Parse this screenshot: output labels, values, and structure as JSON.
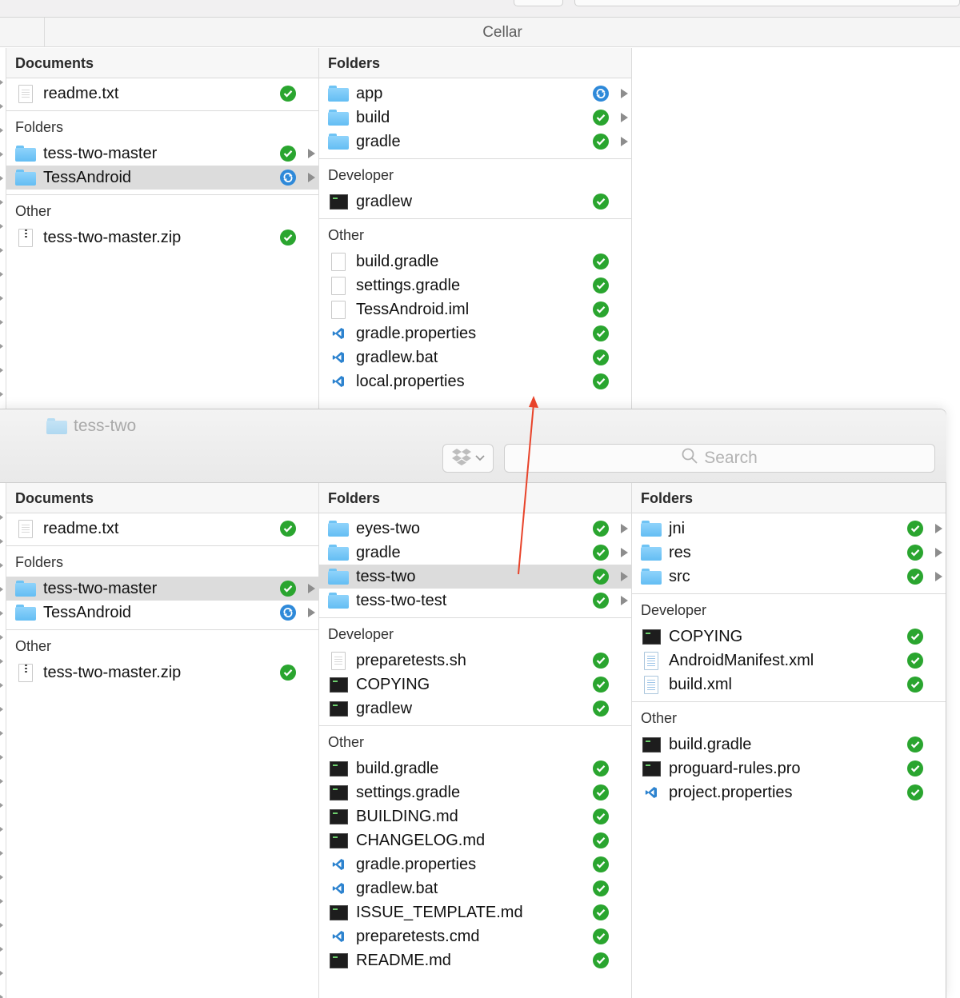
{
  "back_window": {
    "path_title": "Cellar",
    "col1": {
      "header": "Documents",
      "groups": [
        {
          "label": "",
          "rows": [
            {
              "name": "readme.txt",
              "icon": "text-file-icon",
              "status": "ok",
              "chev": false,
              "selected": false
            }
          ]
        },
        {
          "label": "Folders",
          "rows": [
            {
              "name": "tess-two-master",
              "icon": "folder-icon",
              "status": "ok",
              "chev": true,
              "selected": false
            },
            {
              "name": "TessAndroid",
              "icon": "folder-icon",
              "status": "sync",
              "chev": true,
              "selected": true
            }
          ]
        },
        {
          "label": "Other",
          "rows": [
            {
              "name": "tess-two-master.zip",
              "icon": "zip-file-icon",
              "status": "ok",
              "chev": false,
              "selected": false
            }
          ]
        }
      ]
    },
    "col2": {
      "header": "Folders",
      "groups": [
        {
          "label": "",
          "rows": [
            {
              "name": "app",
              "icon": "folder-icon",
              "status": "sync",
              "chev": true,
              "selected": false
            },
            {
              "name": "build",
              "icon": "folder-icon",
              "status": "ok",
              "chev": true,
              "selected": false
            },
            {
              "name": "gradle",
              "icon": "folder-icon",
              "status": "ok",
              "chev": true,
              "selected": false
            }
          ]
        },
        {
          "label": "Developer",
          "rows": [
            {
              "name": "gradlew",
              "icon": "terminal-file-icon",
              "status": "ok",
              "chev": false,
              "selected": false
            }
          ]
        },
        {
          "label": "Other",
          "rows": [
            {
              "name": "build.gradle",
              "icon": "blank-file-icon",
              "status": "ok",
              "chev": false,
              "selected": false
            },
            {
              "name": "settings.gradle",
              "icon": "blank-file-icon",
              "status": "ok",
              "chev": false,
              "selected": false
            },
            {
              "name": "TessAndroid.iml",
              "icon": "blank-file-icon",
              "status": "ok",
              "chev": false,
              "selected": false
            },
            {
              "name": "gradle.properties",
              "icon": "vscode-file-icon",
              "status": "ok",
              "chev": false,
              "selected": false
            },
            {
              "name": "gradlew.bat",
              "icon": "vscode-file-icon",
              "status": "ok",
              "chev": false,
              "selected": false
            },
            {
              "name": "local.properties",
              "icon": "vscode-file-icon",
              "status": "ok",
              "chev": false,
              "selected": false
            }
          ]
        }
      ]
    }
  },
  "front_window": {
    "title": "tess-two",
    "search_placeholder": "Search",
    "col1": {
      "header": "Documents",
      "groups": [
        {
          "label": "",
          "rows": [
            {
              "name": "readme.txt",
              "icon": "text-file-icon",
              "status": "ok",
              "chev": false,
              "selected": false
            }
          ]
        },
        {
          "label": "Folders",
          "rows": [
            {
              "name": "tess-two-master",
              "icon": "folder-icon",
              "status": "ok",
              "chev": true,
              "selected": true
            },
            {
              "name": "TessAndroid",
              "icon": "folder-icon",
              "status": "sync",
              "chev": true,
              "selected": false
            }
          ]
        },
        {
          "label": "Other",
          "rows": [
            {
              "name": "tess-two-master.zip",
              "icon": "zip-file-icon",
              "status": "ok",
              "chev": false,
              "selected": false
            }
          ]
        }
      ]
    },
    "col2": {
      "header": "Folders",
      "groups": [
        {
          "label": "",
          "rows": [
            {
              "name": "eyes-two",
              "icon": "folder-icon",
              "status": "ok",
              "chev": true,
              "selected": false
            },
            {
              "name": "gradle",
              "icon": "folder-icon",
              "status": "ok",
              "chev": true,
              "selected": false
            },
            {
              "name": "tess-two",
              "icon": "folder-icon",
              "status": "ok",
              "chev": true,
              "selected": true
            },
            {
              "name": "tess-two-test",
              "icon": "folder-icon",
              "status": "ok",
              "chev": true,
              "selected": false
            }
          ]
        },
        {
          "label": "Developer",
          "rows": [
            {
              "name": "preparetests.sh",
              "icon": "text-file-icon",
              "status": "ok",
              "chev": false,
              "selected": false
            },
            {
              "name": "COPYING",
              "icon": "terminal-file-icon",
              "status": "ok",
              "chev": false,
              "selected": false
            },
            {
              "name": "gradlew",
              "icon": "terminal-file-icon",
              "status": "ok",
              "chev": false,
              "selected": false
            }
          ]
        },
        {
          "label": "Other",
          "rows": [
            {
              "name": "build.gradle",
              "icon": "terminal-file-icon",
              "status": "ok",
              "chev": false,
              "selected": false
            },
            {
              "name": "settings.gradle",
              "icon": "terminal-file-icon",
              "status": "ok",
              "chev": false,
              "selected": false
            },
            {
              "name": "BUILDING.md",
              "icon": "terminal-file-icon",
              "status": "ok",
              "chev": false,
              "selected": false
            },
            {
              "name": "CHANGELOG.md",
              "icon": "terminal-file-icon",
              "status": "ok",
              "chev": false,
              "selected": false
            },
            {
              "name": "gradle.properties",
              "icon": "vscode-file-icon",
              "status": "ok",
              "chev": false,
              "selected": false
            },
            {
              "name": "gradlew.bat",
              "icon": "vscode-file-icon",
              "status": "ok",
              "chev": false,
              "selected": false
            },
            {
              "name": "ISSUE_TEMPLATE.md",
              "icon": "terminal-file-icon",
              "status": "ok",
              "chev": false,
              "selected": false
            },
            {
              "name": "preparetests.cmd",
              "icon": "vscode-file-icon",
              "status": "ok",
              "chev": false,
              "selected": false
            },
            {
              "name": "README.md",
              "icon": "terminal-file-icon",
              "status": "ok",
              "chev": false,
              "selected": false
            }
          ]
        }
      ]
    },
    "col3": {
      "header": "Folders",
      "groups": [
        {
          "label": "",
          "rows": [
            {
              "name": "jni",
              "icon": "folder-icon",
              "status": "ok",
              "chev": true,
              "selected": false
            },
            {
              "name": "res",
              "icon": "folder-icon",
              "status": "ok",
              "chev": true,
              "selected": false
            },
            {
              "name": "src",
              "icon": "folder-icon",
              "status": "ok",
              "chev": true,
              "selected": false
            }
          ]
        },
        {
          "label": "Developer",
          "rows": [
            {
              "name": "COPYING",
              "icon": "terminal-file-icon",
              "status": "ok",
              "chev": false,
              "selected": false
            },
            {
              "name": "AndroidManifest.xml",
              "icon": "xml-file-icon",
              "status": "ok",
              "chev": false,
              "selected": false
            },
            {
              "name": "build.xml",
              "icon": "xml-file-icon",
              "status": "ok",
              "chev": false,
              "selected": false
            }
          ]
        },
        {
          "label": "Other",
          "rows": [
            {
              "name": "build.gradle",
              "icon": "terminal-file-icon",
              "status": "ok",
              "chev": false,
              "selected": false
            },
            {
              "name": "proguard-rules.pro",
              "icon": "terminal-file-icon",
              "status": "ok",
              "chev": false,
              "selected": false
            },
            {
              "name": "project.properties",
              "icon": "vscode-file-icon",
              "status": "ok",
              "chev": false,
              "selected": false
            }
          ]
        }
      ]
    }
  },
  "colors": {
    "status_ok": "#2aa52f",
    "status_sync": "#2e89d9",
    "selection": "#dcdcdc",
    "annotation_arrow": "#e8432a"
  }
}
